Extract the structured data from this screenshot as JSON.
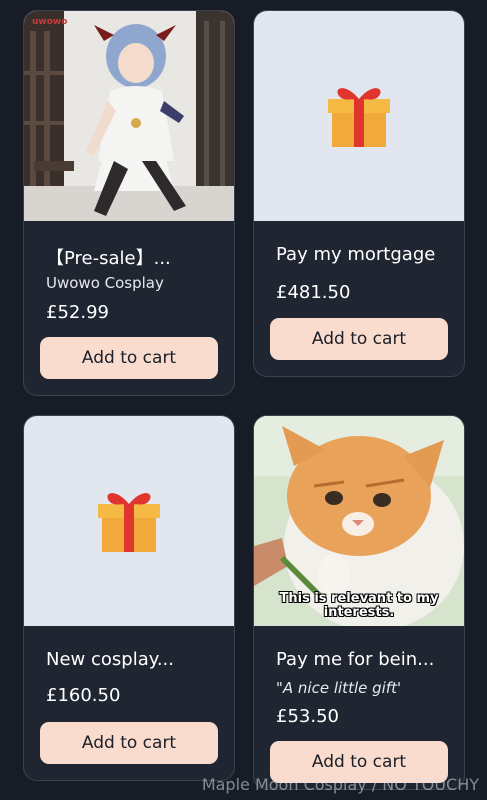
{
  "products": [
    {
      "title": "【Pre-sale】...",
      "seller": "Uwowo Cosplay",
      "price": "£52.99",
      "button_label": "Add to cart",
      "image": "cosplay-photo",
      "logo_text": "uwowo"
    },
    {
      "title": "Pay my mortgage",
      "price": "£481.50",
      "button_label": "Add to cart",
      "image": "gift-icon"
    },
    {
      "title": "New cosplay...",
      "price": "£160.50",
      "button_label": "Add to cart",
      "image": "gift-icon"
    },
    {
      "title": "Pay me for bein...",
      "note": "\"A nice little gift'",
      "price": "£53.50",
      "button_label": "Add to cart",
      "image": "cat-meme",
      "caption": "This is relevant to my interests."
    }
  ],
  "footer": {
    "watermark": "Maple Moon Cosplay / NO TOUCHY"
  },
  "colors": {
    "background": "#171c26",
    "card": "#1f2531",
    "button": "#f9dccd",
    "placeholder": "#e2e6ee"
  }
}
